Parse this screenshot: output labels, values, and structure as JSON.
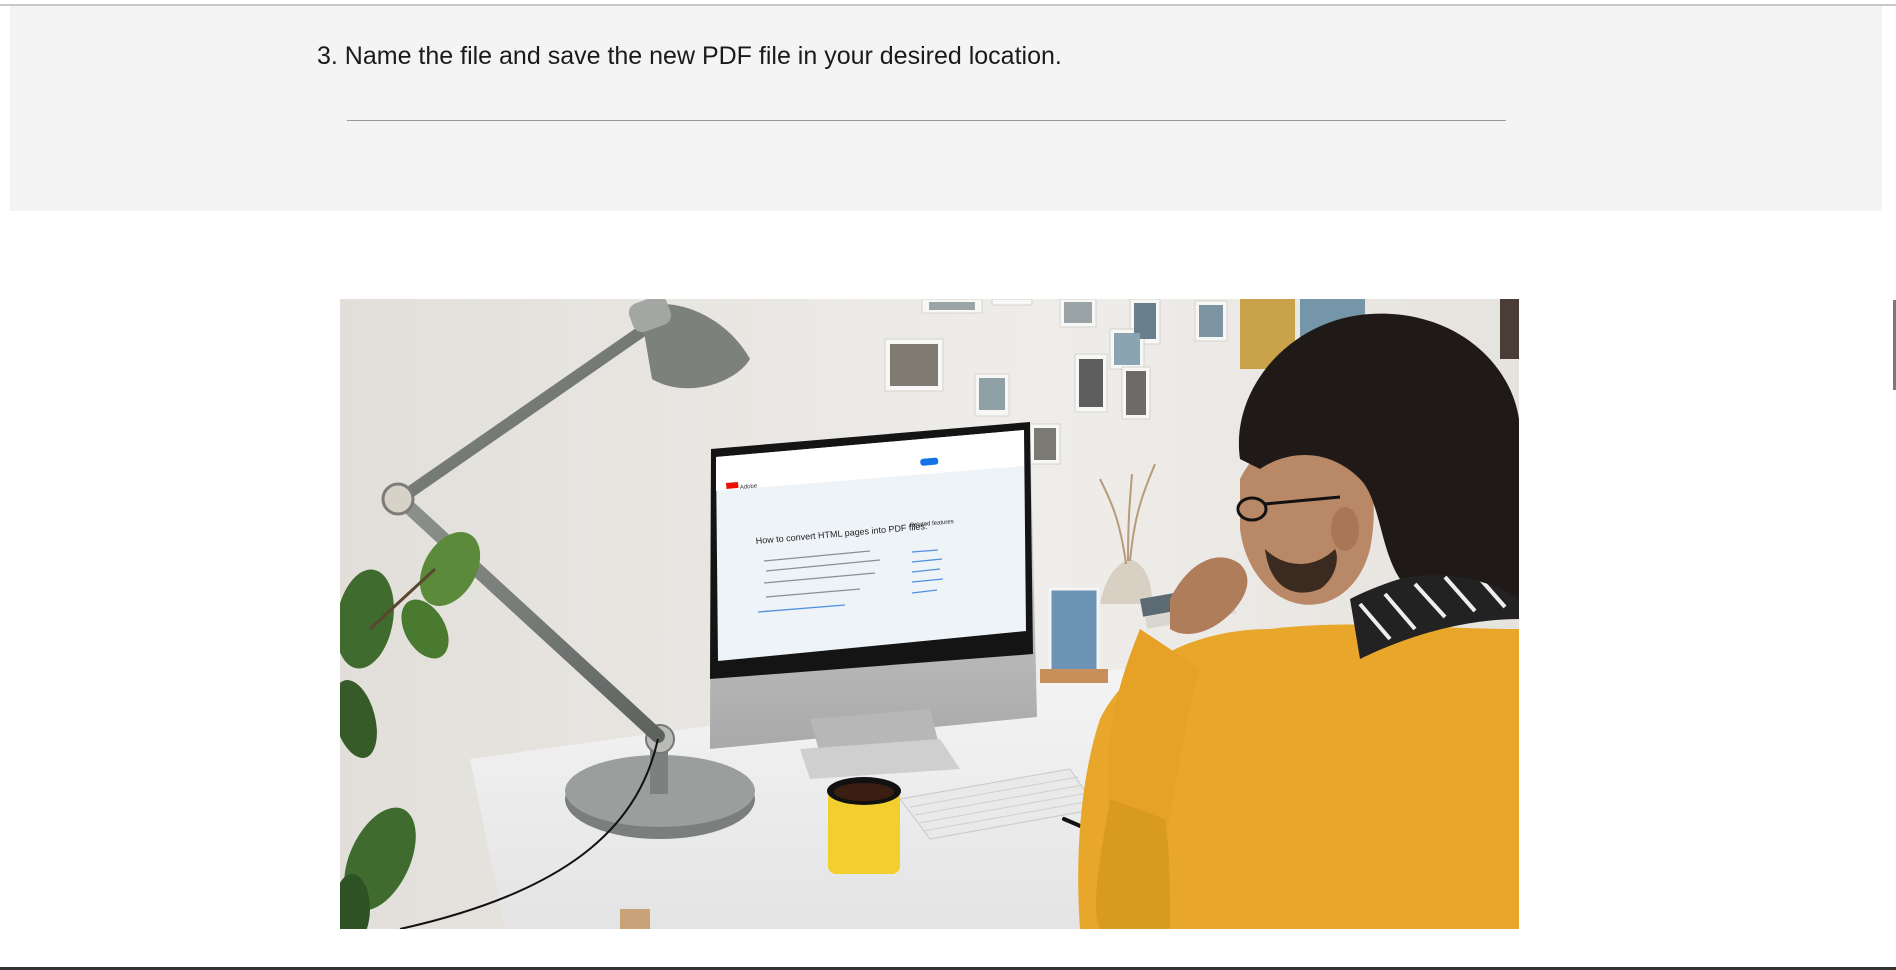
{
  "step": {
    "text": "3. Name the file and save the new PDF file in your desired location."
  },
  "photo": {
    "screen": {
      "logo": "Adobe",
      "heading": "How to convert HTML pages into PDF files:",
      "side_heading": "Related features"
    }
  },
  "colors": {
    "panel_background": "#f4f4f4",
    "divider": "#9a9a9a",
    "sweater": "#e8a72a",
    "mug": "#f2cf2e",
    "adobe_red": "#eb1000",
    "link_blue": "#1473e6"
  }
}
